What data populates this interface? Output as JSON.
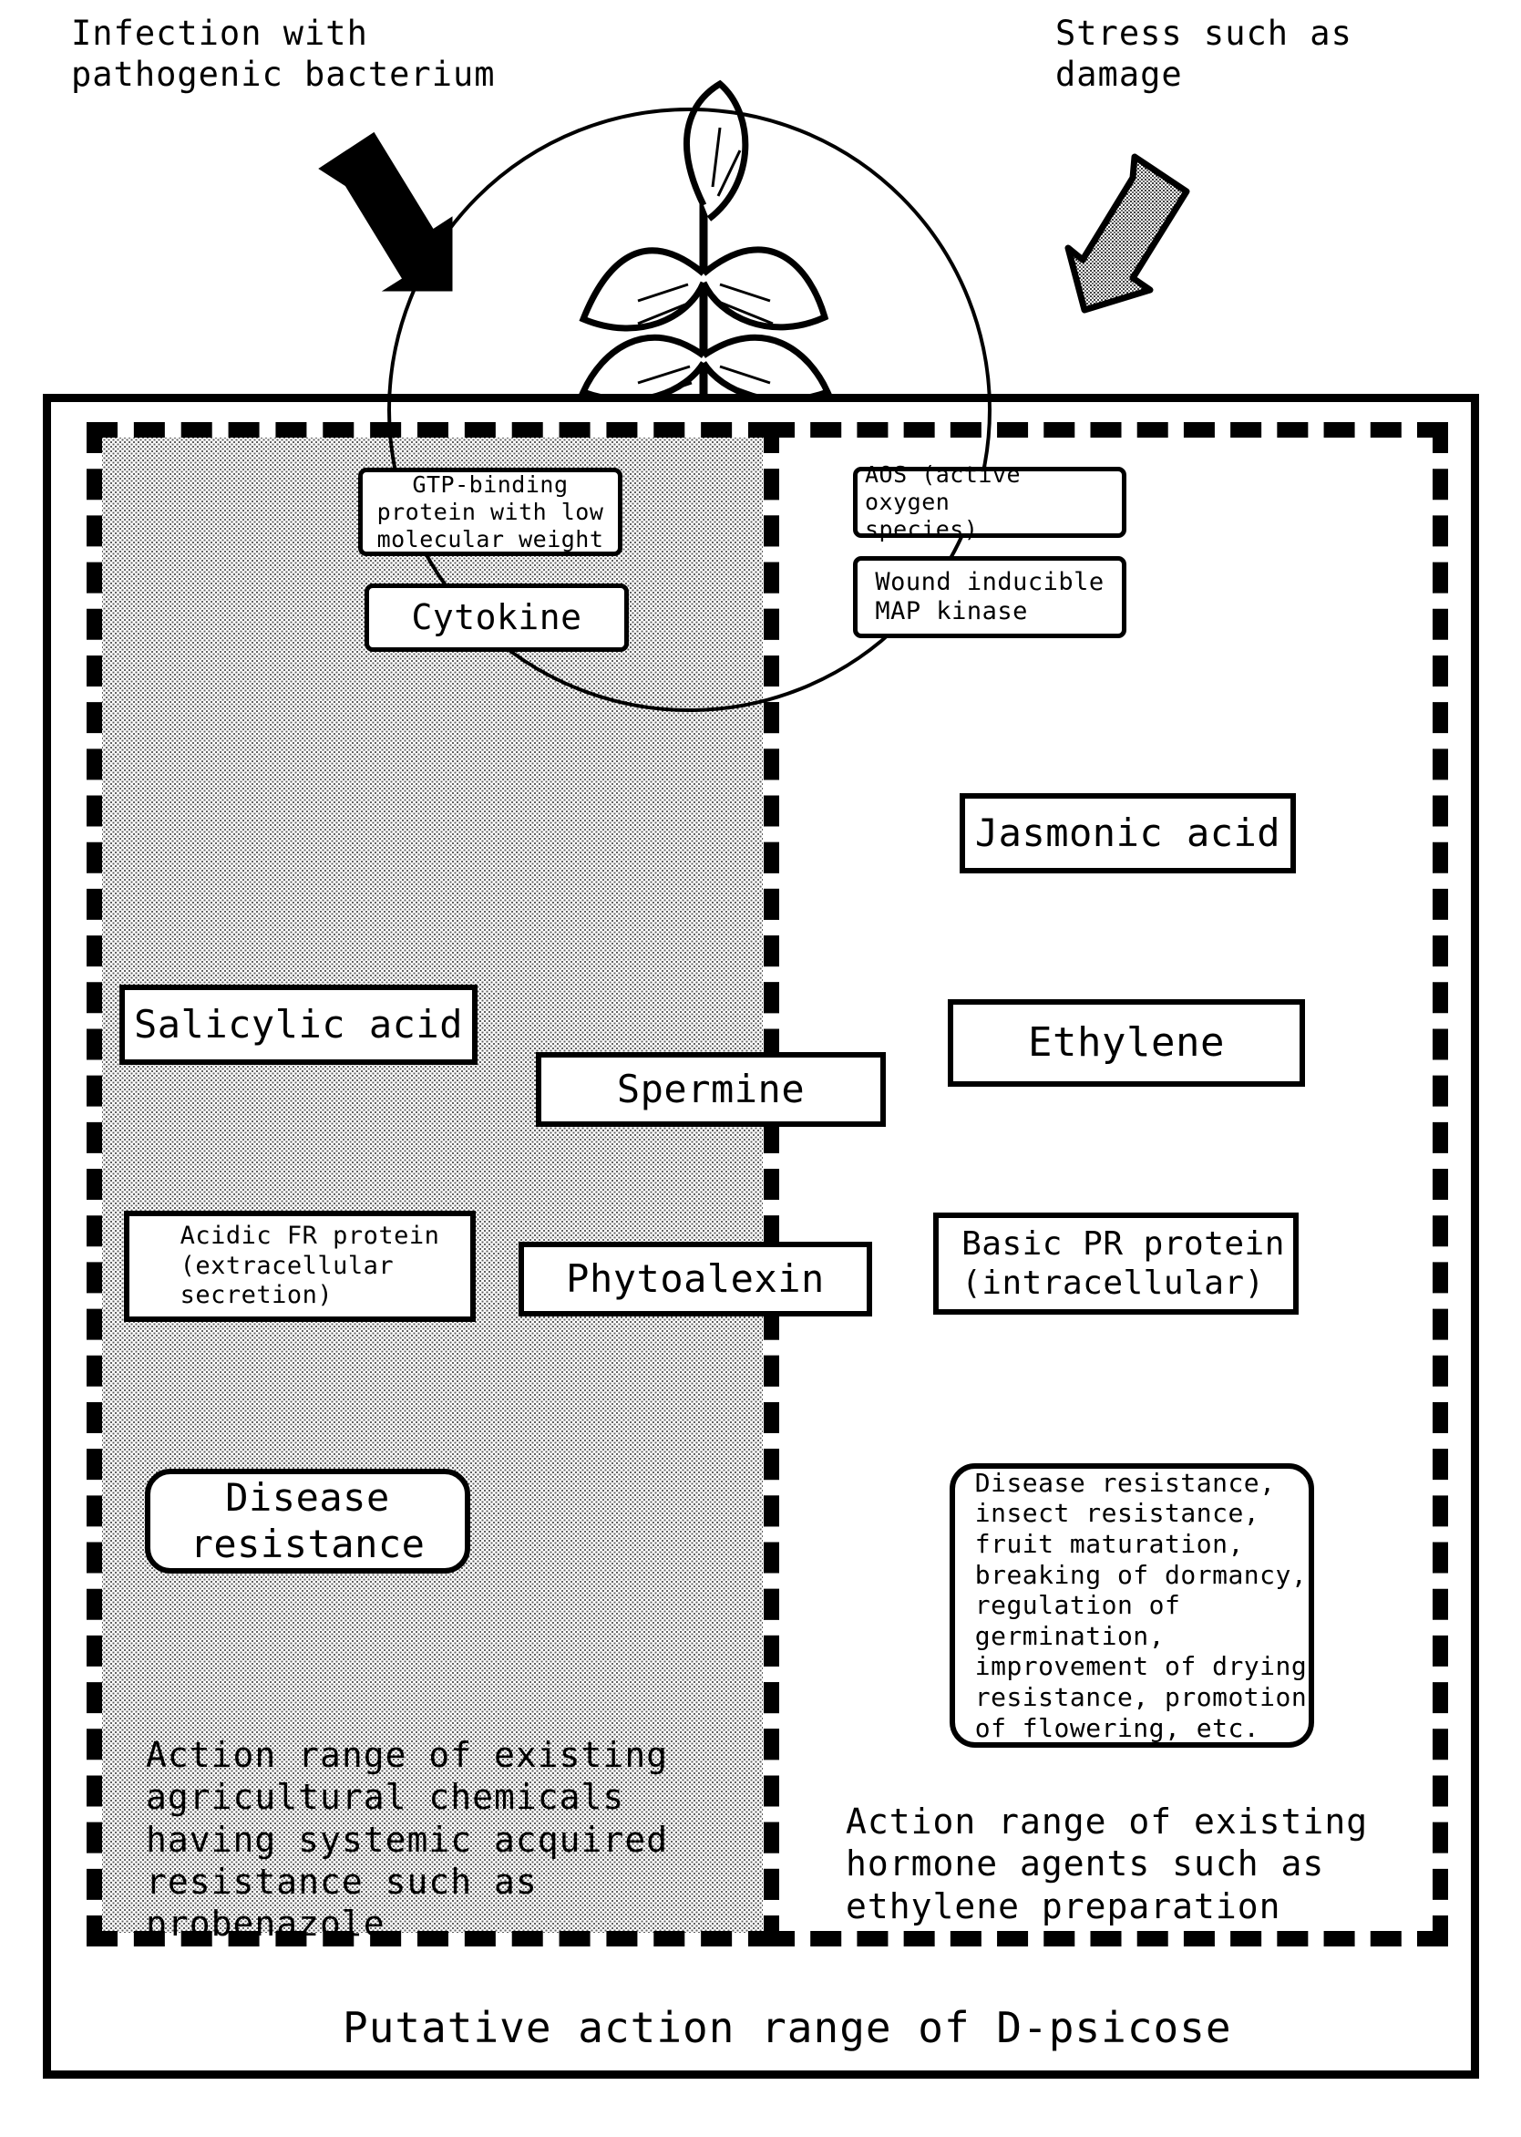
{
  "diagram": {
    "title_bottom": "Putative action range of D-psicose",
    "stimuli": [
      {
        "id": "infection",
        "label": "Infection with\npathogenic bacterium",
        "arrow_style": "solid-black"
      },
      {
        "id": "stress",
        "label": "Stress such as\ndamage",
        "arrow_style": "stippled-gray"
      }
    ],
    "regions": [
      {
        "id": "left-region",
        "label": "Action range of existing\nagricultural chemicals\nhaving systemic acquired\nresistance such as\nprobenazole",
        "fill": "stippled-gray",
        "border": "dashed"
      },
      {
        "id": "right-region",
        "label": "Action range of existing\nhormone agents such as\nethylene preparation",
        "fill": "white",
        "border": "dashed"
      }
    ],
    "nodes": [
      {
        "id": "gtp-binding-protein",
        "label": "GTP-binding\nprotein with low\nmolecular weight",
        "shape": "rounded-rect"
      },
      {
        "id": "cytokine",
        "label": "Cytokine",
        "shape": "rounded-rect"
      },
      {
        "id": "aos",
        "label": "AOS (active oxygen\nspecies)",
        "shape": "rounded-rect"
      },
      {
        "id": "wound-inducible-map-kinase",
        "label": "Wound inducible\nMAP kinase",
        "shape": "rounded-rect"
      },
      {
        "id": "jasmonic-acid",
        "label": "Jasmonic acid",
        "shape": "rect"
      },
      {
        "id": "ethylene",
        "label": "Ethylene",
        "shape": "rect"
      },
      {
        "id": "salicylic-acid",
        "label": "Salicylic acid",
        "shape": "rect"
      },
      {
        "id": "spermine",
        "label": "Spermine",
        "shape": "rect"
      },
      {
        "id": "acidic-pr-protein",
        "label": "Acidic FR protein\n(extracellular\nsecretion)",
        "shape": "rect"
      },
      {
        "id": "phytoalexin",
        "label": "Phytoalexin",
        "shape": "rect"
      },
      {
        "id": "basic-pr-protein",
        "label": "Basic PR protein\n(intracellular)",
        "shape": "rect"
      },
      {
        "id": "disease-resistance",
        "label": "Disease\nresistance",
        "shape": "rounded-rect"
      },
      {
        "id": "hormone-effects",
        "label": "Disease resistance,\ninsect resistance,\nfruit maturation,\nbreaking of dormancy,\nregulation of\ngermination,\nimprovement of drying\nresistance, promotion\nof flowering, etc.",
        "shape": "rounded-rect"
      }
    ],
    "edges": [
      {
        "from": "plant",
        "to": "cytokine-branch",
        "style": "solid"
      },
      {
        "from": "cytokine",
        "to": "salicylic-acid",
        "style": "solid"
      },
      {
        "from": "plant",
        "to": "spermine",
        "style": "solid"
      },
      {
        "from": "spermine",
        "to": "acidic-pr-protein",
        "style": "solid"
      },
      {
        "from": "salicylic-acid",
        "to": "acidic-pr-protein",
        "style": "solid"
      },
      {
        "from": "acidic-pr-protein",
        "to": "disease-resistance",
        "style": "solid"
      },
      {
        "from": "map-kinase",
        "to": "jasmonic-acid",
        "style": "dashed"
      },
      {
        "from": "jasmonic-acid",
        "to": "ethylene",
        "style": "dashed"
      },
      {
        "from": "ethylene",
        "to": "basic-pr-protein",
        "style": "dashed"
      },
      {
        "from": "spermine",
        "to": "basic-pr-protein",
        "style": "dashed"
      },
      {
        "from": "basic-pr-protein",
        "to": "hormone-effects",
        "style": "dashed"
      },
      {
        "from": "ethylene-right",
        "to": "hormone-effects",
        "style": "dashed"
      }
    ],
    "colors": {
      "ink": "#000000",
      "paper": "#ffffff",
      "region_fill": "#9b9b9b"
    }
  }
}
